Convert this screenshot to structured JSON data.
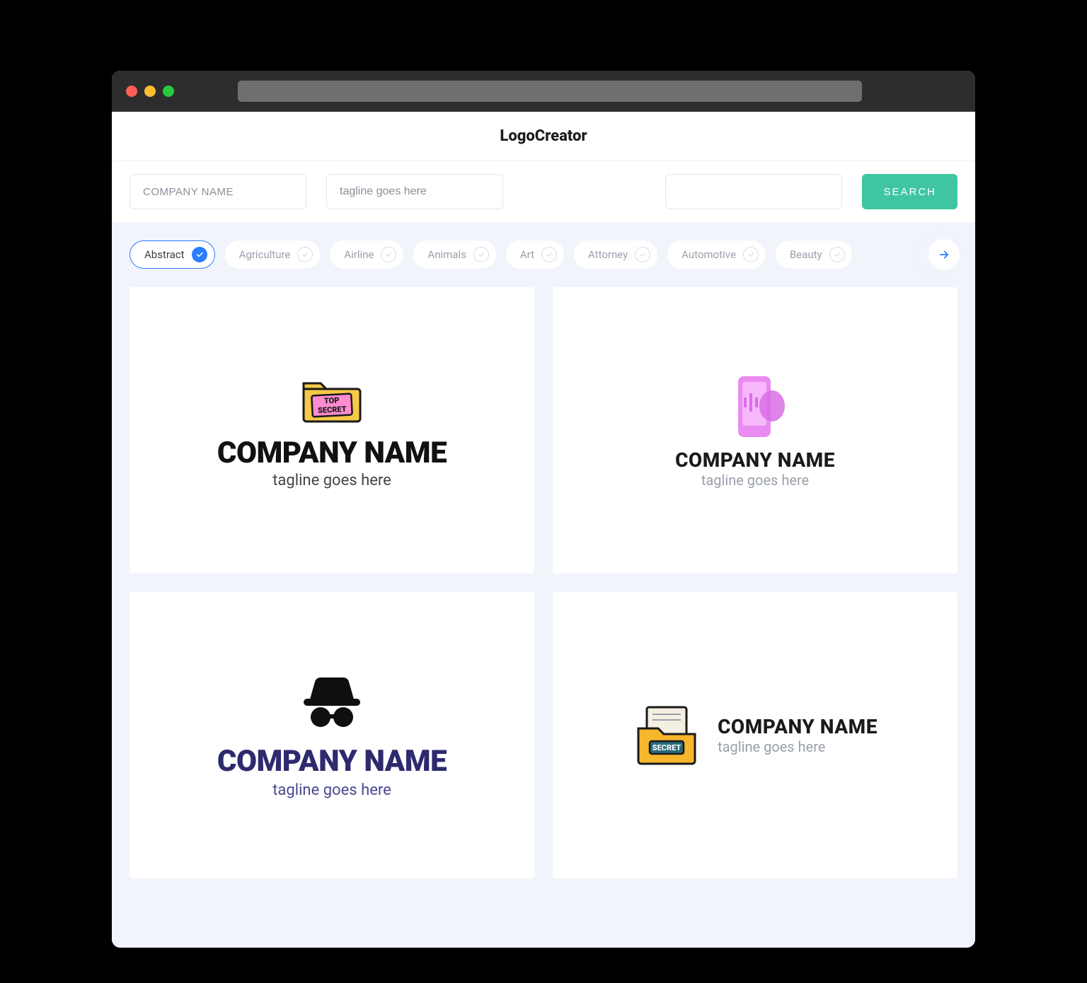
{
  "brand": "LogoCreator",
  "inputs": {
    "company_placeholder": "COMPANY NAME",
    "tagline_placeholder": "tagline goes here",
    "blank_placeholder": ""
  },
  "search_button": "SEARCH",
  "filters": [
    {
      "label": "Abstract",
      "active": true
    },
    {
      "label": "Agriculture",
      "active": false
    },
    {
      "label": "Airline",
      "active": false
    },
    {
      "label": "Animals",
      "active": false
    },
    {
      "label": "Art",
      "active": false
    },
    {
      "label": "Attorney",
      "active": false
    },
    {
      "label": "Automotive",
      "active": false
    },
    {
      "label": "Beauty",
      "active": false
    }
  ],
  "cards": [
    {
      "title": "COMPANY NAME",
      "tagline": "tagline goes here",
      "icon": "top-secret-folder",
      "icon_text1": "TOP",
      "icon_text2": "SECRET"
    },
    {
      "title": "COMPANY NAME",
      "tagline": "tagline goes here",
      "icon": "phone-shape"
    },
    {
      "title": "COMPANY NAME",
      "tagline": "tagline goes here",
      "icon": "incognito"
    },
    {
      "title": "COMPANY NAME",
      "tagline": "tagline goes here",
      "icon": "secret-folder",
      "icon_text": "SECRET"
    }
  ]
}
